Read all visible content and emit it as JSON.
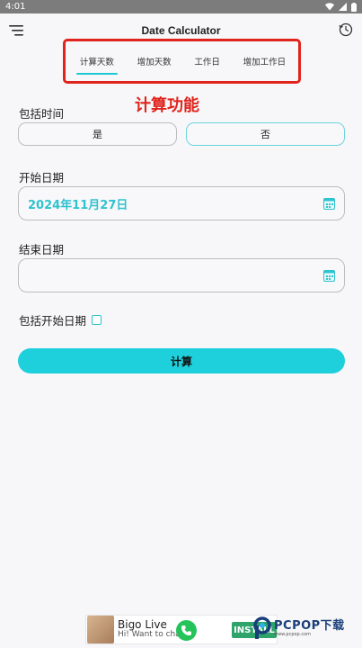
{
  "status_bar": {
    "time": "4:01"
  },
  "app_bar": {
    "title": "Date Calculator"
  },
  "tabs": [
    {
      "label": "计算天数",
      "active": true
    },
    {
      "label": "增加天数",
      "active": false
    },
    {
      "label": "工作日",
      "active": false
    },
    {
      "label": "增加工作日",
      "active": false
    }
  ],
  "annotation": "计算功能",
  "include_time": {
    "label": "包括时间",
    "options": [
      "是",
      "否"
    ],
    "selected": "否"
  },
  "start_date": {
    "label": "开始日期",
    "value": "2024年11月27日"
  },
  "end_date": {
    "label": "结束日期",
    "value": ""
  },
  "include_start": {
    "label": "包括开始日期",
    "checked": false
  },
  "calculate_button": "计算",
  "ad": {
    "title": "Bigo Live",
    "subtitle": "Hi! Want to chat?",
    "install_label": "INSTALL"
  },
  "watermark": {
    "main": "PCPOP下载",
    "sub": "www.pcpop.com"
  },
  "colors": {
    "accent": "#1ecfdc",
    "accent_text": "#2fc2cf",
    "highlight_red": "#e0241c"
  }
}
